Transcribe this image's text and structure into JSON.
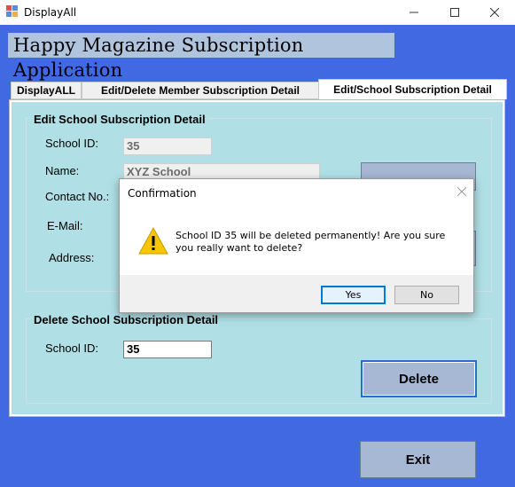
{
  "window": {
    "title": "DisplayAll",
    "minimize_icon": "minimize-icon",
    "maximize_icon": "maximize-icon",
    "close_icon": "close-icon"
  },
  "app": {
    "heading": "Happy Magazine Subscription Application",
    "background_color": "#4169e1"
  },
  "tabs": [
    {
      "label": "DisplayALL",
      "active": false
    },
    {
      "label": "Edit/Delete Member Subscription Detail",
      "active": false
    },
    {
      "label": "Edit/School Subscription Detail",
      "active": true
    }
  ],
  "edit_group": {
    "title": "Edit School Subscription Detail",
    "school_id_label": "School ID:",
    "school_id_value": "35",
    "name_label": "Name:",
    "name_value": "XYZ School",
    "contact_label": "Contact No.:",
    "email_label": "E-Mail:",
    "address_label": "Address:"
  },
  "delete_group": {
    "title": "Delete School Subscription Detail",
    "school_id_label": "School ID:",
    "school_id_value": "35",
    "delete_button": "Delete"
  },
  "exit_button": "Exit",
  "dialog": {
    "title": "Confirmation",
    "message": "School ID 35 will be deleted permanently! Are you sure you really want to delete?",
    "icon": "warning-icon",
    "yes_button": "Yes",
    "no_button": "No"
  }
}
